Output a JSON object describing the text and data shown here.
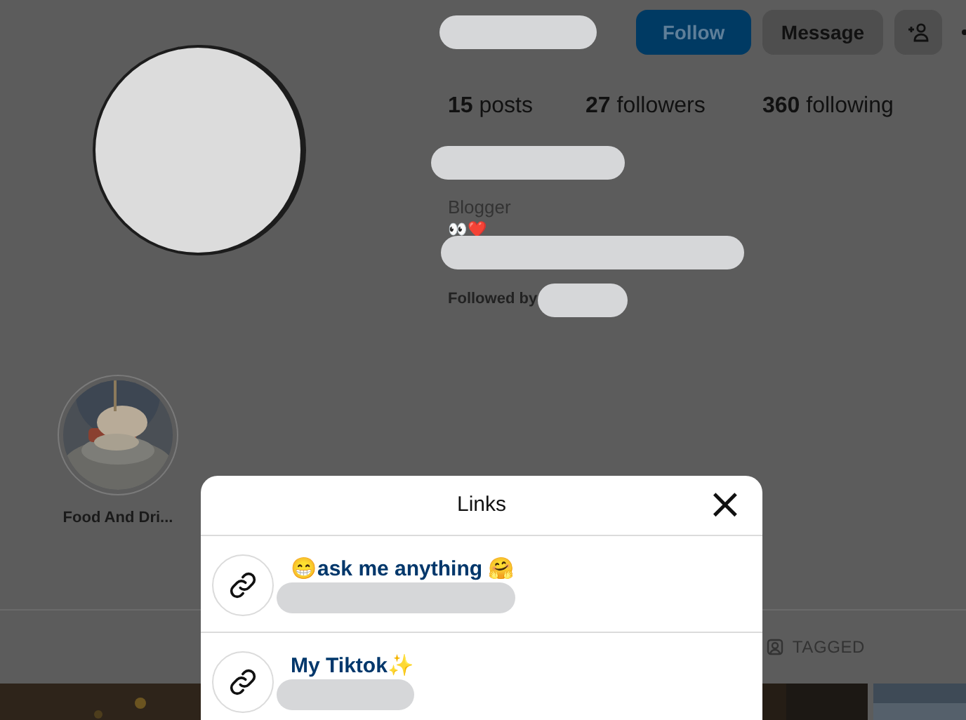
{
  "profile": {
    "buttons": [
      {
        "kind": "primary",
        "label": "Follow"
      },
      {
        "kind": "secondary",
        "label": "Message"
      }
    ],
    "stats": [
      {
        "count": "15",
        "label": "posts"
      },
      {
        "count": "27",
        "label": "followers"
      },
      {
        "count": "360",
        "label": "following"
      }
    ],
    "category": "Blogger",
    "bio_emoji": "👀❤️",
    "followed_by": "Followed by"
  },
  "highlights": [
    {
      "label": "Food And Dri..."
    }
  ],
  "tabs": [
    {
      "label": "TAGGED",
      "selected": false
    }
  ],
  "links_dialog": {
    "title": "Links",
    "close": "×",
    "links": [
      {
        "title": "😁ask me anything 🤗"
      },
      {
        "title": "My Tiktok✨"
      }
    ]
  }
}
